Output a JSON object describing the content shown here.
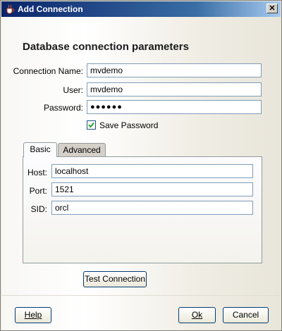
{
  "window": {
    "title": "Add Connection",
    "close_label": "✕"
  },
  "heading": "Database connection parameters",
  "connection": {
    "name_label": "Connection Name:",
    "name_value": "mvdemo",
    "user_label": "User:",
    "user_value": "mvdemo",
    "password_label": "Password:",
    "password_value": "●●●●●●",
    "save_password_label": "Save Password",
    "save_password_checked": true
  },
  "tabs": [
    {
      "label": "Basic",
      "selected": true
    },
    {
      "label": "Advanced",
      "selected": false
    }
  ],
  "basic": {
    "host_label": "Host:",
    "host_value": "localhost",
    "port_label": "Port:",
    "port_value": "1521",
    "sid_label": "SID:",
    "sid_value": "orcl"
  },
  "buttons": {
    "test": "Test Connection",
    "help": "Help",
    "ok": "Ok",
    "cancel": "Cancel"
  },
  "icons": {
    "window": "java-cup-icon",
    "close": "close-icon",
    "check": "checkmark-icon"
  }
}
